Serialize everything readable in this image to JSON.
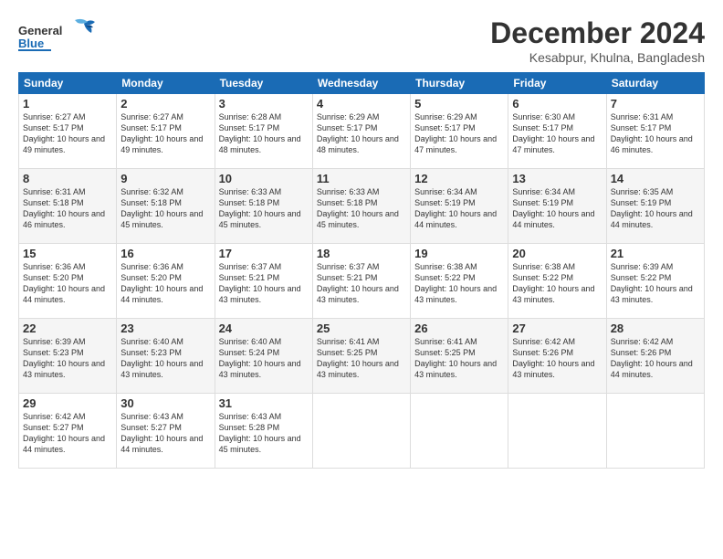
{
  "logo": {
    "line1": "General",
    "line2": "Blue"
  },
  "header": {
    "month": "December 2024",
    "location": "Kesabpur, Khulna, Bangladesh"
  },
  "weekdays": [
    "Sunday",
    "Monday",
    "Tuesday",
    "Wednesday",
    "Thursday",
    "Friday",
    "Saturday"
  ],
  "weeks": [
    [
      {
        "day": 1,
        "sunrise": "6:27 AM",
        "sunset": "5:17 PM",
        "daylight": "10 hours and 49 minutes."
      },
      {
        "day": 2,
        "sunrise": "6:27 AM",
        "sunset": "5:17 PM",
        "daylight": "10 hours and 49 minutes."
      },
      {
        "day": 3,
        "sunrise": "6:28 AM",
        "sunset": "5:17 PM",
        "daylight": "10 hours and 48 minutes."
      },
      {
        "day": 4,
        "sunrise": "6:29 AM",
        "sunset": "5:17 PM",
        "daylight": "10 hours and 48 minutes."
      },
      {
        "day": 5,
        "sunrise": "6:29 AM",
        "sunset": "5:17 PM",
        "daylight": "10 hours and 47 minutes."
      },
      {
        "day": 6,
        "sunrise": "6:30 AM",
        "sunset": "5:17 PM",
        "daylight": "10 hours and 47 minutes."
      },
      {
        "day": 7,
        "sunrise": "6:31 AM",
        "sunset": "5:17 PM",
        "daylight": "10 hours and 46 minutes."
      }
    ],
    [
      {
        "day": 8,
        "sunrise": "6:31 AM",
        "sunset": "5:18 PM",
        "daylight": "10 hours and 46 minutes."
      },
      {
        "day": 9,
        "sunrise": "6:32 AM",
        "sunset": "5:18 PM",
        "daylight": "10 hours and 45 minutes."
      },
      {
        "day": 10,
        "sunrise": "6:33 AM",
        "sunset": "5:18 PM",
        "daylight": "10 hours and 45 minutes."
      },
      {
        "day": 11,
        "sunrise": "6:33 AM",
        "sunset": "5:18 PM",
        "daylight": "10 hours and 45 minutes."
      },
      {
        "day": 12,
        "sunrise": "6:34 AM",
        "sunset": "5:19 PM",
        "daylight": "10 hours and 44 minutes."
      },
      {
        "day": 13,
        "sunrise": "6:34 AM",
        "sunset": "5:19 PM",
        "daylight": "10 hours and 44 minutes."
      },
      {
        "day": 14,
        "sunrise": "6:35 AM",
        "sunset": "5:19 PM",
        "daylight": "10 hours and 44 minutes."
      }
    ],
    [
      {
        "day": 15,
        "sunrise": "6:36 AM",
        "sunset": "5:20 PM",
        "daylight": "10 hours and 44 minutes."
      },
      {
        "day": 16,
        "sunrise": "6:36 AM",
        "sunset": "5:20 PM",
        "daylight": "10 hours and 44 minutes."
      },
      {
        "day": 17,
        "sunrise": "6:37 AM",
        "sunset": "5:21 PM",
        "daylight": "10 hours and 43 minutes."
      },
      {
        "day": 18,
        "sunrise": "6:37 AM",
        "sunset": "5:21 PM",
        "daylight": "10 hours and 43 minutes."
      },
      {
        "day": 19,
        "sunrise": "6:38 AM",
        "sunset": "5:22 PM",
        "daylight": "10 hours and 43 minutes."
      },
      {
        "day": 20,
        "sunrise": "6:38 AM",
        "sunset": "5:22 PM",
        "daylight": "10 hours and 43 minutes."
      },
      {
        "day": 21,
        "sunrise": "6:39 AM",
        "sunset": "5:22 PM",
        "daylight": "10 hours and 43 minutes."
      }
    ],
    [
      {
        "day": 22,
        "sunrise": "6:39 AM",
        "sunset": "5:23 PM",
        "daylight": "10 hours and 43 minutes."
      },
      {
        "day": 23,
        "sunrise": "6:40 AM",
        "sunset": "5:23 PM",
        "daylight": "10 hours and 43 minutes."
      },
      {
        "day": 24,
        "sunrise": "6:40 AM",
        "sunset": "5:24 PM",
        "daylight": "10 hours and 43 minutes."
      },
      {
        "day": 25,
        "sunrise": "6:41 AM",
        "sunset": "5:25 PM",
        "daylight": "10 hours and 43 minutes."
      },
      {
        "day": 26,
        "sunrise": "6:41 AM",
        "sunset": "5:25 PM",
        "daylight": "10 hours and 43 minutes."
      },
      {
        "day": 27,
        "sunrise": "6:42 AM",
        "sunset": "5:26 PM",
        "daylight": "10 hours and 43 minutes."
      },
      {
        "day": 28,
        "sunrise": "6:42 AM",
        "sunset": "5:26 PM",
        "daylight": "10 hours and 44 minutes."
      }
    ],
    [
      {
        "day": 29,
        "sunrise": "6:42 AM",
        "sunset": "5:27 PM",
        "daylight": "10 hours and 44 minutes."
      },
      {
        "day": 30,
        "sunrise": "6:43 AM",
        "sunset": "5:27 PM",
        "daylight": "10 hours and 44 minutes."
      },
      {
        "day": 31,
        "sunrise": "6:43 AM",
        "sunset": "5:28 PM",
        "daylight": "10 hours and 45 minutes."
      },
      null,
      null,
      null,
      null
    ]
  ]
}
